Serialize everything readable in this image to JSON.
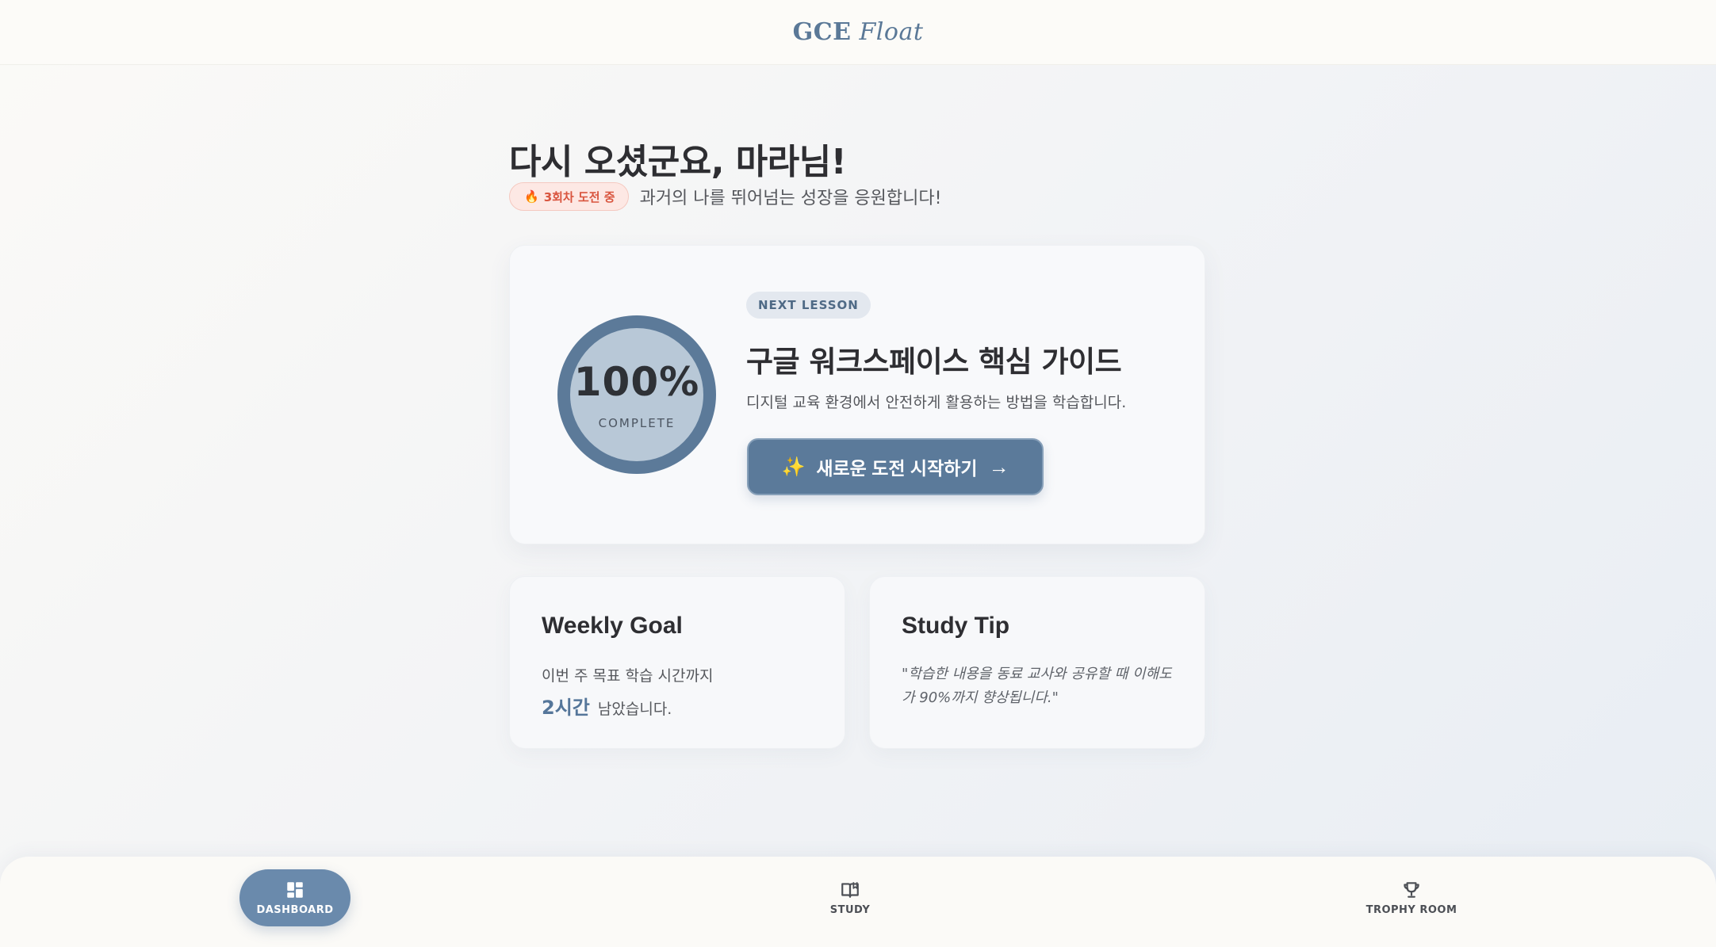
{
  "header": {
    "brand_bold": "GCE",
    "brand_italic": "Float"
  },
  "greeting": {
    "title": "다시 오셨군요, 마라님!",
    "streak_badge": "3회차 도전 중",
    "subtitle": "과거의 나를 뛰어넘는 성장을 응원합니다!"
  },
  "lesson": {
    "progress_value": "100%",
    "progress_label": "COMPLETE",
    "progress_fraction": 1.0,
    "tag": "NEXT LESSON",
    "title": "구글 워크스페이스 핵심 가이드",
    "description": "디지털 교육 환경에서 안전하게 활용하는 방법을 학습합니다.",
    "start_button": "새로운 도전 시작하기"
  },
  "weekly_goal": {
    "heading": "Weekly Goal",
    "line1": "이번 주 목표 학습 시간까지",
    "hours": "2시간",
    "line2_suffix": "남았습니다."
  },
  "study_tip": {
    "heading": "Study Tip",
    "text": "\"학습한 내용을 동료 교사와 공유할 때 이해도가 90%까지 향상됩니다.\""
  },
  "nav": {
    "items": [
      {
        "label": "DASHBOARD",
        "icon": "dashboard-icon",
        "active": true
      },
      {
        "label": "STUDY",
        "icon": "book-icon",
        "active": false
      },
      {
        "label": "TROPHY ROOM",
        "icon": "trophy-icon",
        "active": false
      }
    ]
  },
  "colors": {
    "accent": "#5b7a9a",
    "ring": "#5c7a99",
    "ring_inner": "#b8c8d7",
    "streak": "#d9553f"
  }
}
